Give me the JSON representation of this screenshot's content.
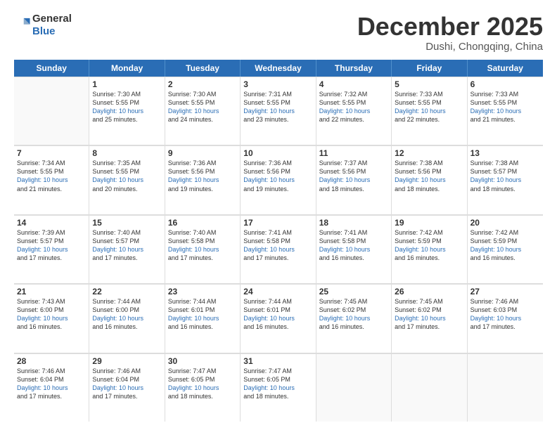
{
  "header": {
    "logo_line1": "General",
    "logo_line2": "Blue",
    "month": "December 2025",
    "location": "Dushi, Chongqing, China"
  },
  "days_of_week": [
    "Sunday",
    "Monday",
    "Tuesday",
    "Wednesday",
    "Thursday",
    "Friday",
    "Saturday"
  ],
  "weeks": [
    [
      {
        "day": "",
        "info": ""
      },
      {
        "day": "1",
        "info": "Sunrise: 7:30 AM\nSunset: 5:55 PM\nDaylight: 10 hours\nand 25 minutes."
      },
      {
        "day": "2",
        "info": "Sunrise: 7:30 AM\nSunset: 5:55 PM\nDaylight: 10 hours\nand 24 minutes."
      },
      {
        "day": "3",
        "info": "Sunrise: 7:31 AM\nSunset: 5:55 PM\nDaylight: 10 hours\nand 23 minutes."
      },
      {
        "day": "4",
        "info": "Sunrise: 7:32 AM\nSunset: 5:55 PM\nDaylight: 10 hours\nand 22 minutes."
      },
      {
        "day": "5",
        "info": "Sunrise: 7:33 AM\nSunset: 5:55 PM\nDaylight: 10 hours\nand 22 minutes."
      },
      {
        "day": "6",
        "info": "Sunrise: 7:33 AM\nSunset: 5:55 PM\nDaylight: 10 hours\nand 21 minutes."
      }
    ],
    [
      {
        "day": "7",
        "info": "Sunrise: 7:34 AM\nSunset: 5:55 PM\nDaylight: 10 hours\nand 21 minutes."
      },
      {
        "day": "8",
        "info": "Sunrise: 7:35 AM\nSunset: 5:55 PM\nDaylight: 10 hours\nand 20 minutes."
      },
      {
        "day": "9",
        "info": "Sunrise: 7:36 AM\nSunset: 5:56 PM\nDaylight: 10 hours\nand 19 minutes."
      },
      {
        "day": "10",
        "info": "Sunrise: 7:36 AM\nSunset: 5:56 PM\nDaylight: 10 hours\nand 19 minutes."
      },
      {
        "day": "11",
        "info": "Sunrise: 7:37 AM\nSunset: 5:56 PM\nDaylight: 10 hours\nand 18 minutes."
      },
      {
        "day": "12",
        "info": "Sunrise: 7:38 AM\nSunset: 5:56 PM\nDaylight: 10 hours\nand 18 minutes."
      },
      {
        "day": "13",
        "info": "Sunrise: 7:38 AM\nSunset: 5:57 PM\nDaylight: 10 hours\nand 18 minutes."
      }
    ],
    [
      {
        "day": "14",
        "info": "Sunrise: 7:39 AM\nSunset: 5:57 PM\nDaylight: 10 hours\nand 17 minutes."
      },
      {
        "day": "15",
        "info": "Sunrise: 7:40 AM\nSunset: 5:57 PM\nDaylight: 10 hours\nand 17 minutes."
      },
      {
        "day": "16",
        "info": "Sunrise: 7:40 AM\nSunset: 5:58 PM\nDaylight: 10 hours\nand 17 minutes."
      },
      {
        "day": "17",
        "info": "Sunrise: 7:41 AM\nSunset: 5:58 PM\nDaylight: 10 hours\nand 17 minutes."
      },
      {
        "day": "18",
        "info": "Sunrise: 7:41 AM\nSunset: 5:58 PM\nDaylight: 10 hours\nand 16 minutes."
      },
      {
        "day": "19",
        "info": "Sunrise: 7:42 AM\nSunset: 5:59 PM\nDaylight: 10 hours\nand 16 minutes."
      },
      {
        "day": "20",
        "info": "Sunrise: 7:42 AM\nSunset: 5:59 PM\nDaylight: 10 hours\nand 16 minutes."
      }
    ],
    [
      {
        "day": "21",
        "info": "Sunrise: 7:43 AM\nSunset: 6:00 PM\nDaylight: 10 hours\nand 16 minutes."
      },
      {
        "day": "22",
        "info": "Sunrise: 7:44 AM\nSunset: 6:00 PM\nDaylight: 10 hours\nand 16 minutes."
      },
      {
        "day": "23",
        "info": "Sunrise: 7:44 AM\nSunset: 6:01 PM\nDaylight: 10 hours\nand 16 minutes."
      },
      {
        "day": "24",
        "info": "Sunrise: 7:44 AM\nSunset: 6:01 PM\nDaylight: 10 hours\nand 16 minutes."
      },
      {
        "day": "25",
        "info": "Sunrise: 7:45 AM\nSunset: 6:02 PM\nDaylight: 10 hours\nand 16 minutes."
      },
      {
        "day": "26",
        "info": "Sunrise: 7:45 AM\nSunset: 6:02 PM\nDaylight: 10 hours\nand 17 minutes."
      },
      {
        "day": "27",
        "info": "Sunrise: 7:46 AM\nSunset: 6:03 PM\nDaylight: 10 hours\nand 17 minutes."
      }
    ],
    [
      {
        "day": "28",
        "info": "Sunrise: 7:46 AM\nSunset: 6:04 PM\nDaylight: 10 hours\nand 17 minutes."
      },
      {
        "day": "29",
        "info": "Sunrise: 7:46 AM\nSunset: 6:04 PM\nDaylight: 10 hours\nand 17 minutes."
      },
      {
        "day": "30",
        "info": "Sunrise: 7:47 AM\nSunset: 6:05 PM\nDaylight: 10 hours\nand 18 minutes."
      },
      {
        "day": "31",
        "info": "Sunrise: 7:47 AM\nSunset: 6:05 PM\nDaylight: 10 hours\nand 18 minutes."
      },
      {
        "day": "",
        "info": ""
      },
      {
        "day": "",
        "info": ""
      },
      {
        "day": "",
        "info": ""
      }
    ]
  ]
}
